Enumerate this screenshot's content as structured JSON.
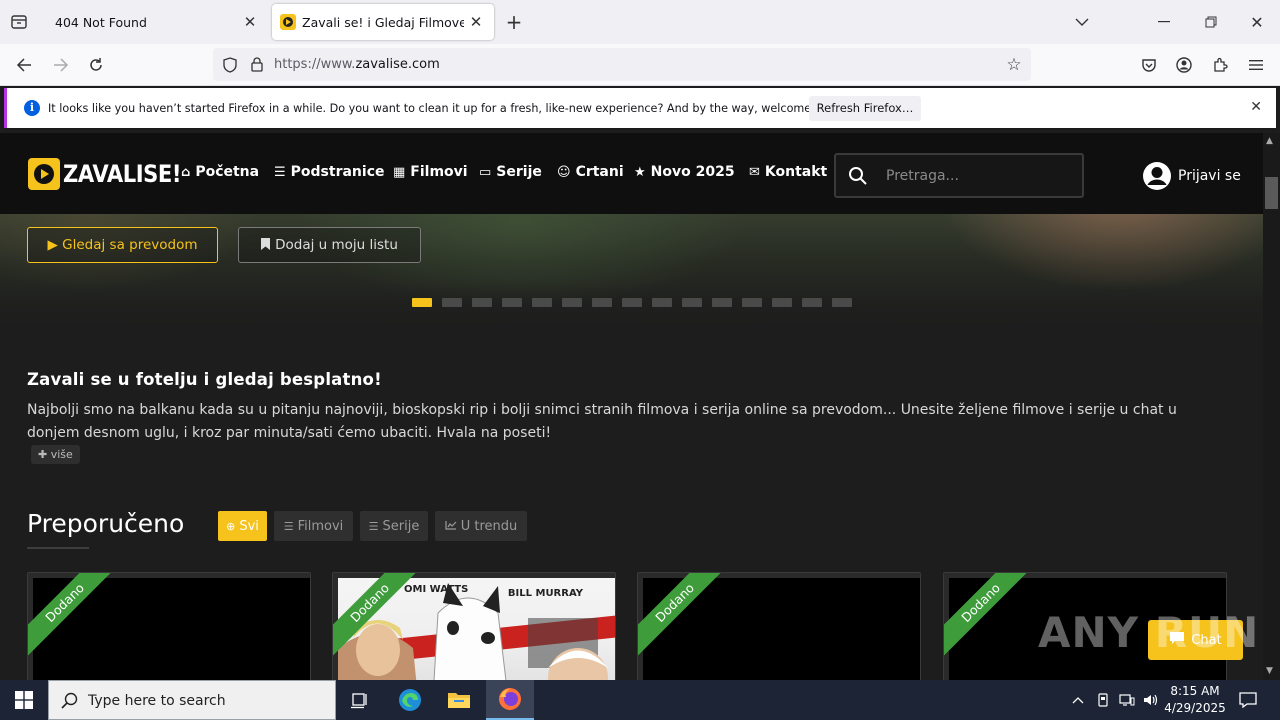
{
  "browser": {
    "tabs": [
      {
        "title": "404 Not Found"
      },
      {
        "title": "Zavali se! i Gledaj Filmove, Serije"
      }
    ],
    "url_scheme": "https://www.",
    "url_domain": "zavalise.com",
    "notification": {
      "message": "It looks like you haven’t started Firefox in a while. Do you want to clean it up for a fresh, like-new experience? And by the way, welcome back!",
      "button": "Refresh Firefox…"
    }
  },
  "site": {
    "logo_text": "ZAVALISE!",
    "nav": [
      {
        "label": "Početna",
        "icon": "home-icon",
        "glyph": "⌂"
      },
      {
        "label": "Podstranice",
        "icon": "bars-icon",
        "glyph": "☰"
      },
      {
        "label": "Filmovi",
        "icon": "film-icon",
        "glyph": "▦"
      },
      {
        "label": "Serije",
        "icon": "tv-icon",
        "glyph": "▭"
      },
      {
        "label": "Crtani",
        "icon": "smile-icon",
        "glyph": "☺"
      },
      {
        "label": "Novo 2025",
        "icon": "star-icon",
        "glyph": "★"
      },
      {
        "label": "Kontakt",
        "icon": "envelope-icon",
        "glyph": "✉"
      }
    ],
    "search_placeholder": "Pretraga...",
    "login": "Prijavi se",
    "hero": {
      "watch_btn": "▶ Gledaj sa prevodom",
      "list_btn": "Dodaj u moju listu",
      "slide_count": 15,
      "active_slide": 1
    },
    "about": {
      "title": "Zavali se u fotelju i gledaj besplatno!",
      "text": "Najbolji smo na balkanu kada su u pitanju najnoviji, bioskopski rip i bolji snimci stranih filmova i serija online sa prevodom... Unesite željene filmove i serije u chat u donjem desnom uglu, i kroz par minuta/sati ćemo ubaciti. Hvala na poseti!",
      "more": "više"
    },
    "recommended": {
      "title": "Preporučeno",
      "filters": [
        {
          "label": "Svi",
          "active": true
        },
        {
          "label": "Filmovi",
          "active": false
        },
        {
          "label": "Serije",
          "active": false
        },
        {
          "label": "U trendu",
          "active": false
        }
      ],
      "cards": [
        {
          "badge": "Dodano",
          "poster_top_left": "",
          "poster_top_right": ""
        },
        {
          "badge": "Dodano",
          "poster_top_left": "OMI WATTS",
          "poster_top_right": "BILL MURRAY"
        },
        {
          "badge": "Dodano",
          "poster_top_left": "",
          "poster_top_right": ""
        },
        {
          "badge": "Dodano",
          "poster_top_left": "",
          "poster_top_right": ""
        }
      ]
    },
    "chat_label": "Chat",
    "watermark": "ANY RUN"
  },
  "taskbar": {
    "search_placeholder": "Type here to search",
    "time": "8:15 AM",
    "date": "4/29/2025"
  },
  "colors": {
    "accent": "#f6c21c",
    "badge_green": "#3e9c3b",
    "page_bg": "#1d1d1d",
    "nav_bg": "#0f0f0f"
  }
}
